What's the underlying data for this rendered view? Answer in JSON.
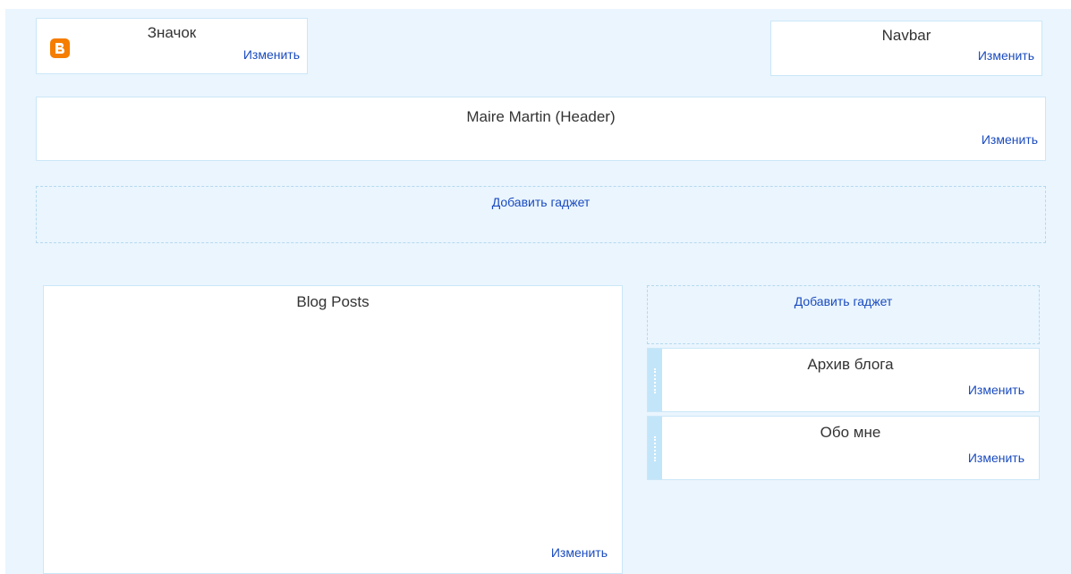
{
  "favicon": {
    "title": "Значок",
    "edit_label": "Изменить"
  },
  "navbar": {
    "title": "Navbar",
    "edit_label": "Изменить"
  },
  "header": {
    "title": "Maire Martin (Header)",
    "edit_label": "Изменить"
  },
  "add_gadget_top": {
    "label": "Добавить гаджет"
  },
  "main": {
    "title": "Blog Posts",
    "edit_label": "Изменить"
  },
  "sidebar": {
    "add_gadget_label": "Добавить гаджет",
    "gadgets": [
      {
        "title": "Архив блога",
        "edit_label": "Изменить"
      },
      {
        "title": "Обо мне",
        "edit_label": "Изменить"
      }
    ]
  },
  "colors": {
    "canvas": "#eaf5fe",
    "link": "#1a4bbf",
    "blogger_orange": "#f57d00"
  },
  "icons": {
    "favicon": "blogger-icon"
  }
}
